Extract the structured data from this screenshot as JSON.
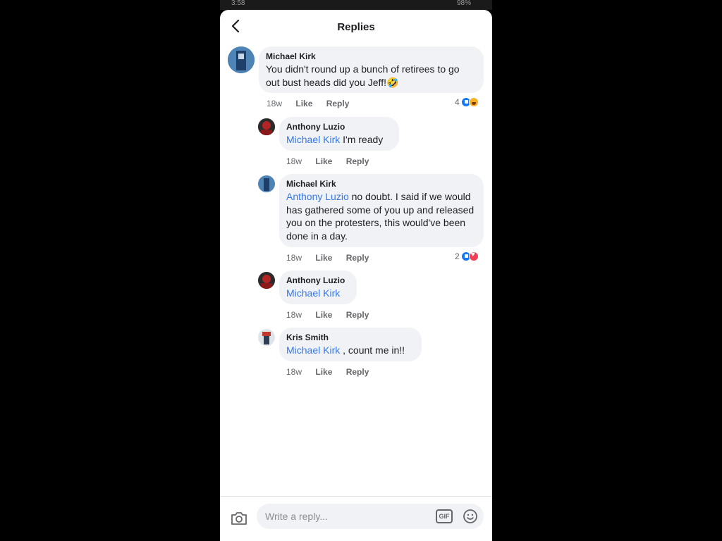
{
  "status_bar": {
    "time": "3:58",
    "battery": "98%"
  },
  "header": {
    "title": "Replies"
  },
  "comments": [
    {
      "author": "Michael Kirk",
      "mention": "",
      "text": "You didn't round up a bunch of retirees to go out bust heads did you Jeff!🤣",
      "time": "18w",
      "like": "Like",
      "reply": "Reply",
      "reactions": "4"
    },
    {
      "author": "Anthony Luzio",
      "mention": "Michael Kirk",
      "text": " I'm ready",
      "time": "18w",
      "like": "Like",
      "reply": "Reply"
    },
    {
      "author": "Michael Kirk",
      "mention": "Anthony Luzio",
      "text": " no doubt. I said if we would has gathered some of you up and released you on the protesters,  this would've been done in a day.",
      "time": "18w",
      "like": "Like",
      "reply": "Reply",
      "reactions": "2"
    },
    {
      "author": "Anthony Luzio",
      "mention": "Michael Kirk",
      "text": "",
      "time": "18w",
      "like": "Like",
      "reply": "Reply"
    },
    {
      "author": "Kris Smith",
      "mention": "Michael Kirk",
      "text": " , count me in!!",
      "time": "18w",
      "like": "Like",
      "reply": "Reply"
    }
  ],
  "composer": {
    "placeholder": "Write a reply...",
    "gif_label": "GIF"
  },
  "colors": {
    "mention": "#3578e5",
    "bubble": "#f0f2f5",
    "like": "#1877f2",
    "love": "#f33e58",
    "haha": "#f7b125"
  },
  "icons": {
    "back": "chevron-left-icon",
    "camera": "camera-icon",
    "gif": "gif-icon",
    "emoji": "emoji-icon"
  }
}
